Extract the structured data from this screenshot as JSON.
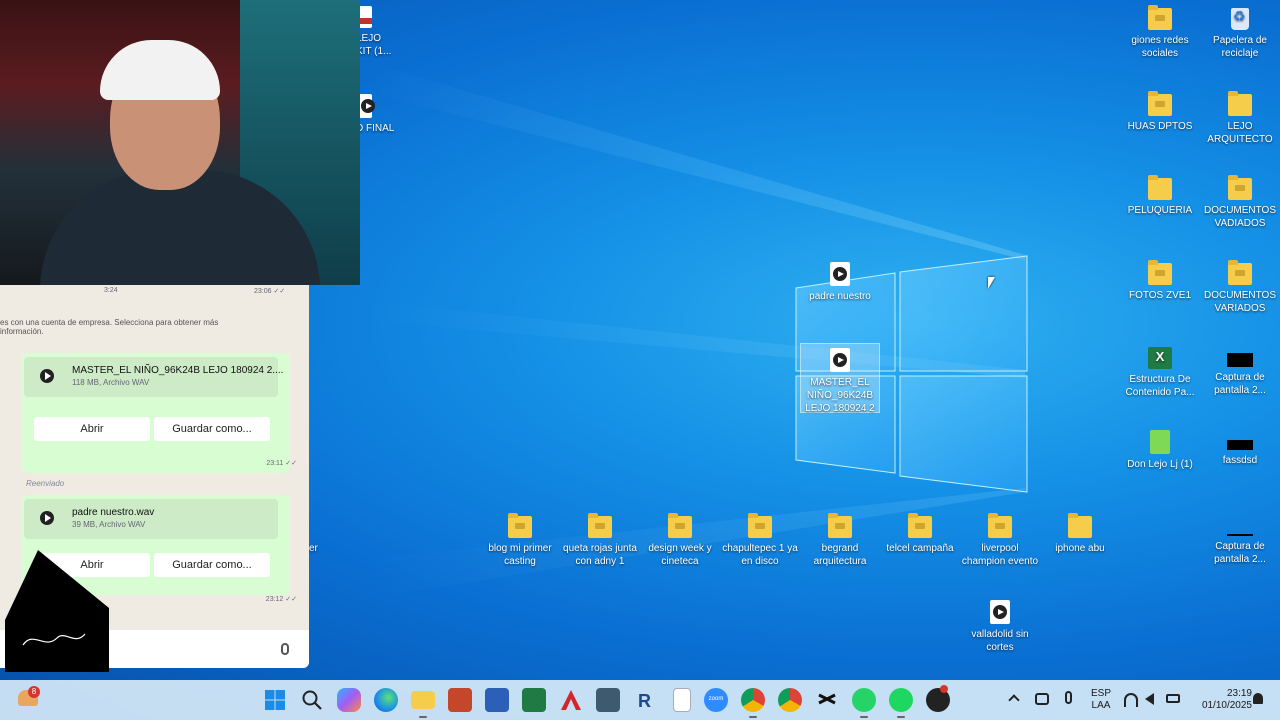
{
  "desktop": {
    "partial_icons": [
      {
        "label": "LEJO\nKIT (1..."
      },
      {
        "label": "D FINAL"
      }
    ],
    "center_files": [
      {
        "label": "padre nuestro",
        "icon": "media-file-icon"
      },
      {
        "label": "MASTER_EL NIÑO_96K24B LEJO 180924 2",
        "icon": "media-file-icon"
      }
    ],
    "right_icons": [
      {
        "label": "giones redes sociales",
        "icon": "folder-icon"
      },
      {
        "label": "Papelera de reciclaje",
        "icon": "recycle-bin-icon"
      },
      {
        "label": "HUAS DPTOS",
        "icon": "folder-icon"
      },
      {
        "label": "LEJO ARQUITECTO",
        "icon": "folder-icon"
      },
      {
        "label": "PELUQUERIA",
        "icon": "folder-icon"
      },
      {
        "label": "DOCUMENTOS VADIADOS",
        "icon": "folder-icon"
      },
      {
        "label": "FOTOS ZVE1",
        "icon": "folder-icon"
      },
      {
        "label": "DOCUMENTOS VARIADOS",
        "icon": "folder-icon"
      },
      {
        "label": "Estructura De Contenido Pa...",
        "icon": "excel-file-icon"
      },
      {
        "label": "Captura de pantalla 2...",
        "icon": "screenshot-file-icon"
      },
      {
        "label": "Don Lejo Lj (1)",
        "icon": "green-doc-icon"
      },
      {
        "label": "fassdsd",
        "icon": "screenshot-file-icon"
      },
      {
        "label": "Captura de pantalla 2...",
        "icon": "screenshot-file-icon"
      }
    ],
    "bottom_row": [
      {
        "label": "blog mi primer casting"
      },
      {
        "label": "queta rojas junta con adny 1"
      },
      {
        "label": "design week y cineteca"
      },
      {
        "label": "chapultepec 1 ya en disco"
      },
      {
        "label": "begrand arquitectura"
      },
      {
        "label": "telcel campaña"
      },
      {
        "label": "liverpool champion evento"
      },
      {
        "label": "iphone abu"
      }
    ],
    "extra_file": {
      "label": "valladolid sin cortes"
    },
    "left_edge_fragments": [
      "er"
    ]
  },
  "whatsapp": {
    "top_time_left": "3:24",
    "top_time_right": "23:06 ✓✓",
    "notice": "es con una cuenta de empresa. Selecciona para obtener más información.",
    "messages": [
      {
        "file_name": "MASTER_EL NIÑO_96K24B LEJO 180924 2....",
        "file_meta": "118 MB, Archivo WAV",
        "open_label": "Abrir",
        "save_label": "Guardar como...",
        "time": "23:11 ✓✓"
      },
      {
        "forwarded": "Reenviado",
        "file_name": "padre nuestro.wav",
        "file_meta": "39 MB, Archivo WAV",
        "open_label": "Abrir",
        "save_label": "Guardar como...",
        "time": "23:12 ✓✓"
      }
    ]
  },
  "taskbar": {
    "weather_badge": "8",
    "apps": [
      "windows-start-icon",
      "search-icon",
      "copilot-icon",
      "edge-icon",
      "file-explorer-icon",
      "powerpoint-icon",
      "word-icon",
      "excel-icon",
      "autocad-icon",
      "sketchup-icon",
      "revit-icon",
      "notepad-icon",
      "zoom-icon",
      "chrome-icon",
      "chrome-profile-icon",
      "capcut-icon",
      "whatsapp-icon",
      "spotify-icon",
      "app-badge-icon"
    ],
    "zoom_label": "zoom",
    "language_top": "ESP",
    "language_bottom": "LAA",
    "time": "23:19",
    "date": "01/10/2025"
  },
  "colors": {
    "desktop_blue": "#0a6fd2",
    "taskbar_bg": "#d6e9f7",
    "whatsapp_bubble": "#d9fdd3"
  }
}
